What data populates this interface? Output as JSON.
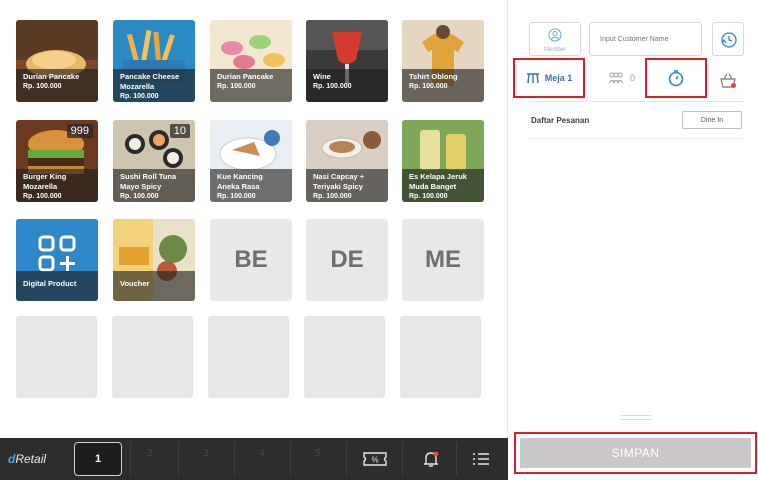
{
  "products": [
    {
      "name": "Durian Pancake",
      "price": "Rp. 100.000",
      "badge": "",
      "image": "durian-pancake"
    },
    {
      "name": "Pancake Cheese\nMozarella",
      "price": "Rp. 100.000",
      "badge": "",
      "image": "fries"
    },
    {
      "name": "Durian Pancake",
      "price": "Rp. 100.000",
      "badge": "",
      "image": "macarons"
    },
    {
      "name": "Wine",
      "price": "Rp. 100.000",
      "badge": "",
      "image": "wine"
    },
    {
      "name": "Tshirt Oblong",
      "price": "Rp. 100.000",
      "badge": "",
      "image": "tshirt"
    },
    {
      "name": "Burger King\nMozarella",
      "price": "Rp. 100.000",
      "badge": "999",
      "image": "burger"
    },
    {
      "name": "Sushi Roll Tuna\nMayo Spicy",
      "price": "Rp. 100.000",
      "badge": "10",
      "image": "sushi"
    },
    {
      "name": "Kue Kancing\nAneka Rasa",
      "price": "Rp. 100.000",
      "badge": "",
      "image": "cake-plate"
    },
    {
      "name": "Nasi Capcay +\nTeriyaki Spicy",
      "price": "Rp. 100.000",
      "badge": "",
      "image": "coffee"
    },
    {
      "name": "Es Kelapa Jeruk\nMuda Banget",
      "price": "Rp. 100.000",
      "badge": "",
      "image": "drink"
    },
    {
      "name": "Digital Product",
      "price": "",
      "badge": "",
      "image": "digital-product-icon"
    },
    {
      "name": "Voucher",
      "price": "",
      "badge": "",
      "image": "voucher"
    }
  ],
  "text_tiles": [
    "BE",
    "DE",
    "ME"
  ],
  "bottom_bar": {
    "logo_d": "d",
    "logo_rest": "Retail",
    "current_page": "1",
    "pages": [
      "2",
      "3",
      "4",
      "5"
    ],
    "icons": [
      "discount-ticket-icon",
      "bell-icon",
      "menu-list-icon"
    ]
  },
  "panel": {
    "member_label": "Member",
    "customer_placeholder": "Input Customer Name",
    "table_label": "Meja 1",
    "guest_count": "0",
    "order_list_label": "Daftar Pesanan",
    "order_type": "Dine In",
    "save_label": "SIMPAN"
  },
  "colors": {
    "highlight": "#d9202a",
    "accent_blue": "#2f86c9",
    "bottom_bar": "#2d2d2d",
    "save_button": "#c8c8c8"
  }
}
